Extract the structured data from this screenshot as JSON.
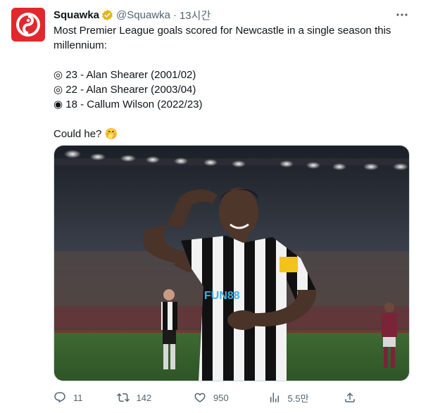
{
  "tweet": {
    "author_name": "Squawka",
    "handle": "@Squawka",
    "separator": "·",
    "time": "13시간",
    "lines": [
      "Most Premier League goals scored for Newcastle in a single season this millennium:",
      "",
      "◎ 23 - Alan Shearer (2001/02)",
      "◎ 22 - Alan Shearer (2003/04)",
      "◉ 18 - Callum Wilson (2022/23)",
      "",
      "Could he? 🤭"
    ]
  },
  "actions": {
    "replies": "11",
    "retweets": "142",
    "likes": "950",
    "views": "5.5만"
  },
  "colors": {
    "brand": "#e1282d",
    "verified": "#e2b719",
    "muted": "#536471"
  }
}
